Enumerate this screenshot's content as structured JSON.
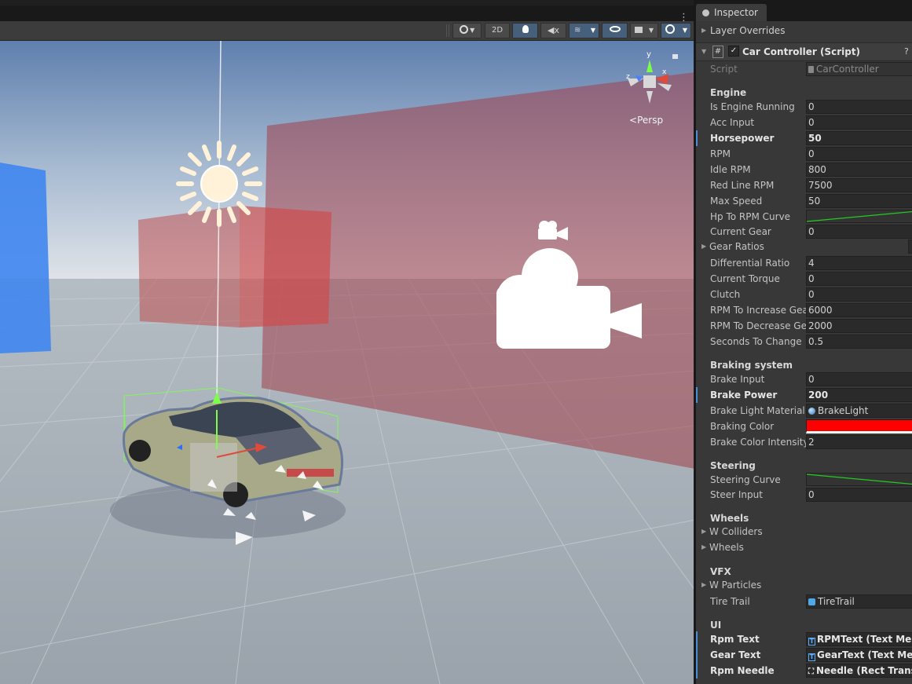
{
  "scene_view": {
    "toolbar": {
      "mode_2d_label": "2D"
    },
    "orientation_label": "Persp"
  },
  "inspector": {
    "tab_title": "Inspector",
    "layer_overrides_label": "Layer Overrides",
    "component_title": "Car Controller (Script)",
    "script_row": {
      "label": "Script",
      "value": "CarController"
    },
    "sections": {
      "engine": "Engine",
      "braking": "Braking system",
      "steering": "Steering",
      "wheels": "Wheels",
      "vfx": "VFX",
      "ui": "UI"
    },
    "engine_rows": [
      {
        "label": "Is Engine Running",
        "value": "0"
      },
      {
        "label": "Acc Input",
        "value": "0"
      },
      {
        "label": "Horsepower",
        "value": "50"
      },
      {
        "label": "RPM",
        "value": "0"
      },
      {
        "label": "Idle RPM",
        "value": "800"
      },
      {
        "label": "Red Line RPM",
        "value": "7500"
      },
      {
        "label": "Max Speed",
        "value": "50"
      },
      {
        "label": "Hp To RPM Curve"
      },
      {
        "label": "Current Gear",
        "value": "0"
      },
      {
        "label": "Gear Ratios"
      },
      {
        "label": "Differential Ratio",
        "value": "4"
      },
      {
        "label": "Current Torque",
        "value": "0"
      },
      {
        "label": "Clutch",
        "value": "0"
      },
      {
        "label": "RPM To Increase Gea",
        "value": "6000"
      },
      {
        "label": "RPM To Decrease Ge",
        "value": "2000"
      },
      {
        "label": "Seconds To Change",
        "value": "0.5"
      }
    ],
    "braking_rows": [
      {
        "label": "Brake Input",
        "value": "0"
      },
      {
        "label": "Brake Power",
        "value": "200"
      },
      {
        "label": "Brake Light Material",
        "value": "BrakeLight"
      },
      {
        "label": "Braking Color",
        "color": "#ff0000"
      },
      {
        "label": "Brake Color Intensity",
        "value": "2"
      }
    ],
    "steering_rows": [
      {
        "label": "Steering Curve"
      },
      {
        "label": "Steer Input",
        "value": "0"
      }
    ],
    "wheels_rows": [
      {
        "label": "W Colliders"
      },
      {
        "label": "Wheels"
      }
    ],
    "vfx_rows": [
      {
        "label": "W Particles"
      },
      {
        "label": "Tire Trail",
        "value": "TireTrail"
      }
    ],
    "ui_rows": [
      {
        "label": "Rpm Text",
        "value": "RPMText (Text Mesh"
      },
      {
        "label": "Gear Text",
        "value": "GearText (Text Mesh"
      },
      {
        "label": "Rpm Needle",
        "value": "Needle (Rect Transfo"
      }
    ]
  },
  "colors": {
    "accent_blue": "#4a90d8",
    "braking_color": "#ff0000",
    "curve_green": "#22cc22"
  }
}
